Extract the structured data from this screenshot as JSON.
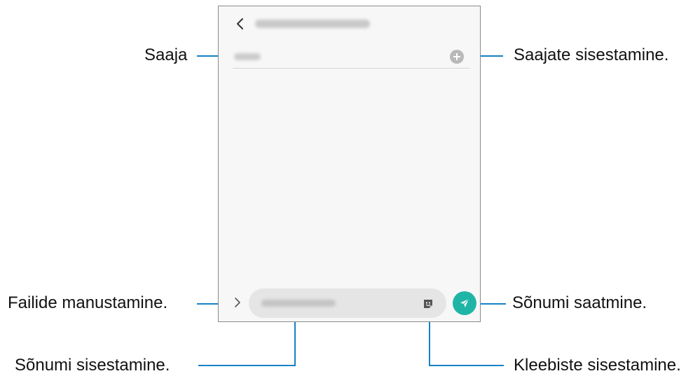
{
  "callouts": {
    "recipient": "Saaja",
    "add_recipients": "Saajate sisestamine.",
    "attach_files": "Failide manustamine.",
    "send_message": "Sõnumi saatmine.",
    "enter_message": "Sõnumi sisestamine.",
    "enter_stickers": "Kleebiste sisestamine."
  },
  "colors": {
    "leader": "#1581c4",
    "send_button": "#1fb5a6",
    "phone_border": "#8a8a8a"
  },
  "icons": [
    "back-icon",
    "add-recipient-icon",
    "expand-icon",
    "sticker-icon",
    "send-icon"
  ]
}
